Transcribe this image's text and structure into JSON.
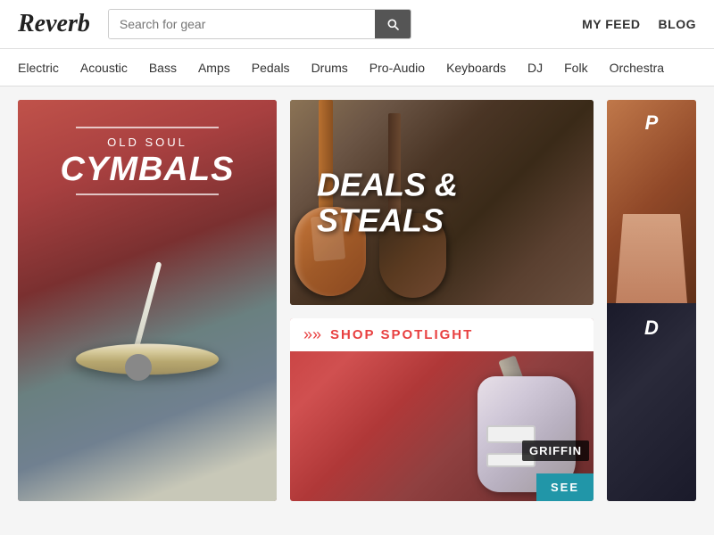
{
  "header": {
    "logo": "Reverb",
    "search_placeholder": "Search for gear",
    "nav_items": [
      {
        "label": "MY FEED",
        "id": "my-feed"
      },
      {
        "label": "BLOG",
        "id": "blog"
      }
    ]
  },
  "category_nav": {
    "items": [
      {
        "label": "Electric",
        "id": "electric"
      },
      {
        "label": "Acoustic",
        "id": "acoustic"
      },
      {
        "label": "Bass",
        "id": "bass"
      },
      {
        "label": "Amps",
        "id": "amps"
      },
      {
        "label": "Pedals",
        "id": "pedals"
      },
      {
        "label": "Drums",
        "id": "drums"
      },
      {
        "label": "Pro-Audio",
        "id": "pro-audio"
      },
      {
        "label": "Keyboards",
        "id": "keyboards"
      },
      {
        "label": "DJ",
        "id": "dj"
      },
      {
        "label": "Folk",
        "id": "folk"
      },
      {
        "label": "Orchestra",
        "id": "orchestra"
      }
    ]
  },
  "cards": {
    "left": {
      "subtitle": "Old Soul",
      "title1": "OLD SOUL",
      "title2": "CYMBALS"
    },
    "deals": {
      "line1": "DEALS &",
      "line2": "STEALS"
    },
    "spotlight": {
      "label": "SHOP SPOTLIGHT",
      "brand": "GRIFFIN",
      "see_label": "SEE"
    },
    "third": {
      "line1": "P",
      "line2": "D"
    }
  }
}
